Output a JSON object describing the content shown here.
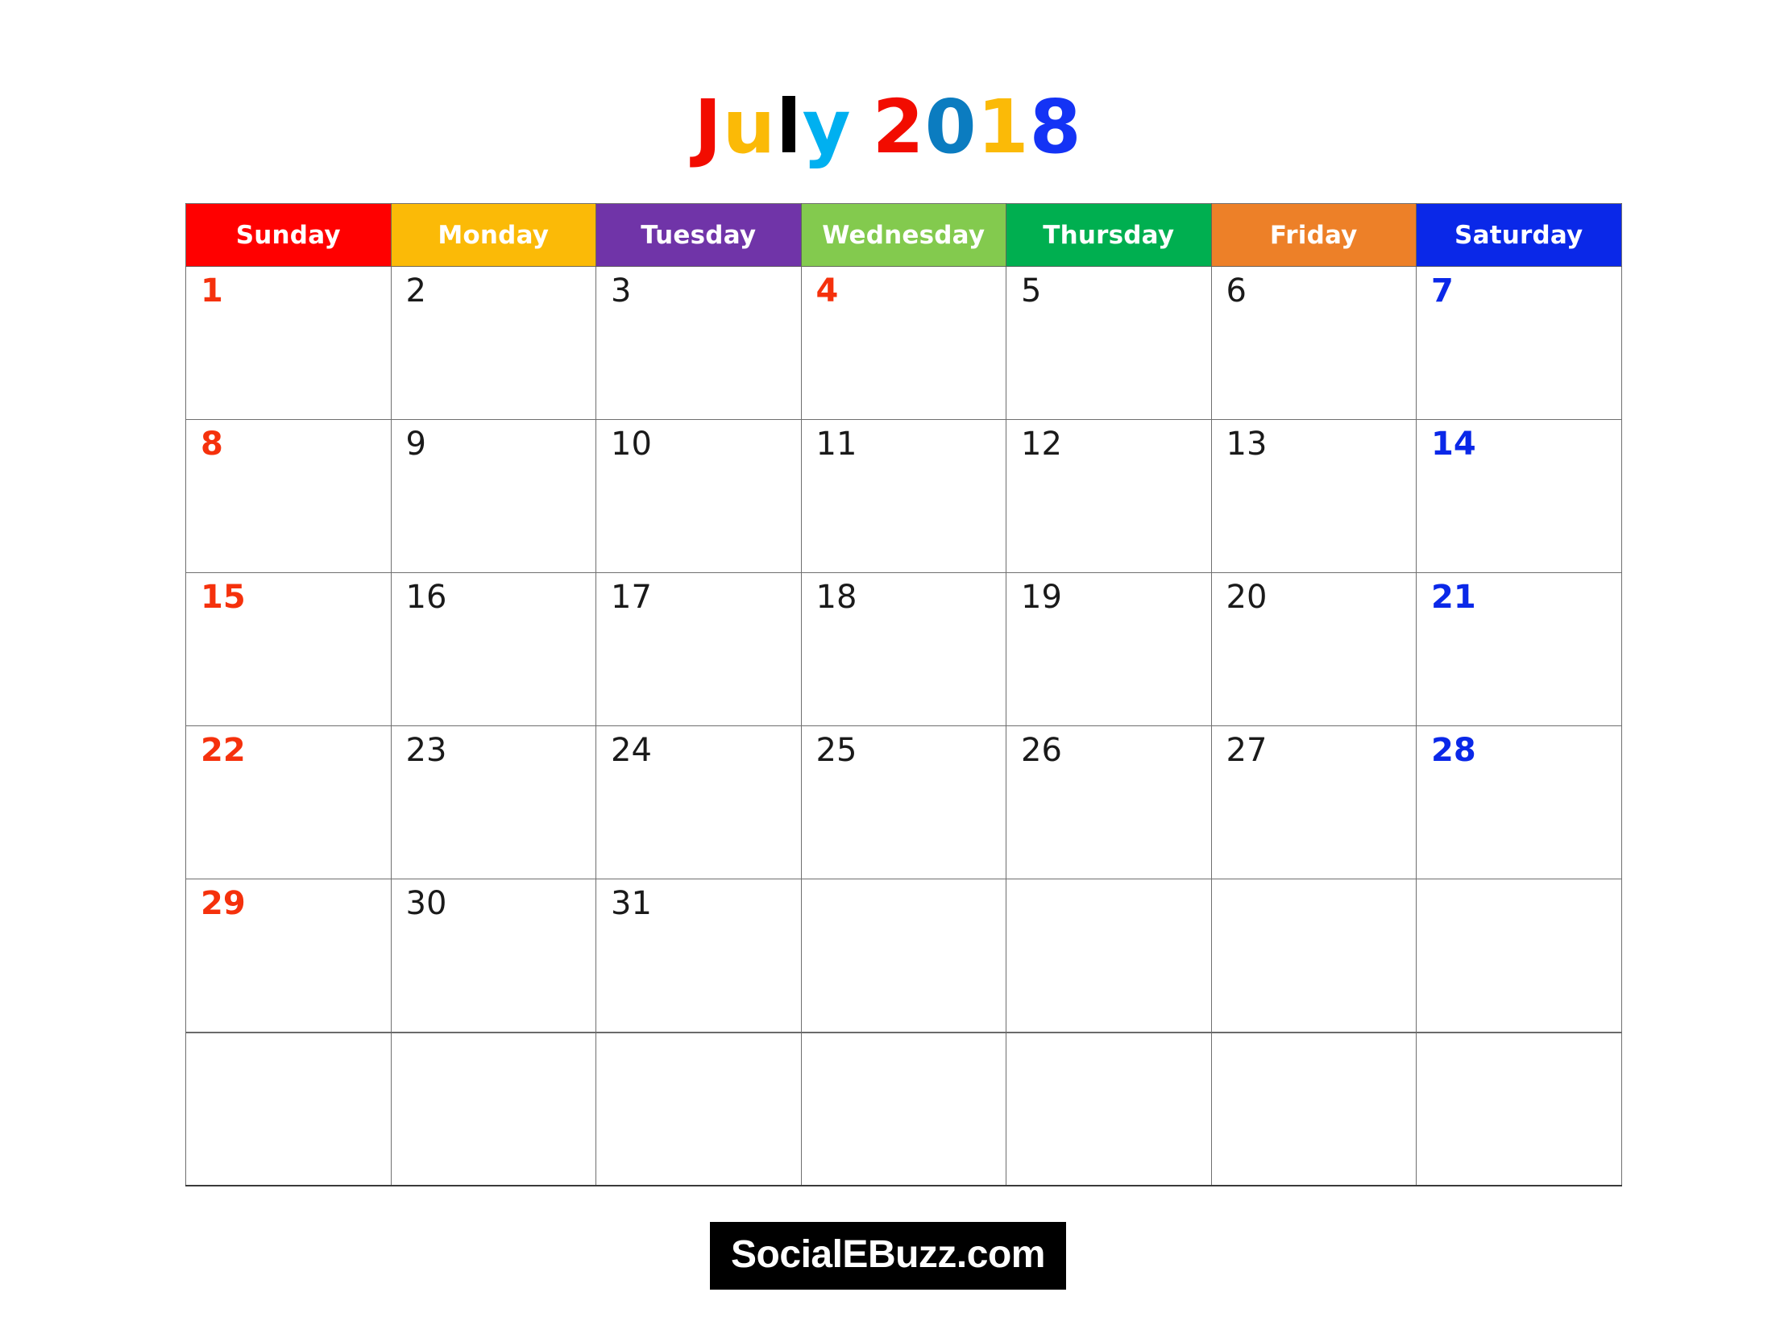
{
  "title": {
    "text": "July 2018",
    "letters": [
      {
        "ch": "J",
        "color": "#F20C00"
      },
      {
        "ch": "u",
        "color": "#FBBA07"
      },
      {
        "ch": "l",
        "color": "#8CC councils"
      },
      {
        "ch": "y",
        "color": "#00B0F0"
      },
      {
        "ch": " ",
        "color": ""
      },
      {
        "ch": "2",
        "color": "#F20C00"
      },
      {
        "ch": "0",
        "color": "#0B7CC0"
      },
      {
        "ch": "1",
        "color": "#FBBA07"
      },
      {
        "ch": "8",
        "color": "#1433F5"
      }
    ]
  },
  "weekdays": [
    {
      "label": "Sunday",
      "bg": "#FF0000"
    },
    {
      "label": "Monday",
      "bg": "#FBBA07"
    },
    {
      "label": "Tuesday",
      "bg": "#7034A8"
    },
    {
      "label": "Wednesday",
      "bg": "#83CA4E"
    },
    {
      "label": "Thursday",
      "bg": "#00AF50"
    },
    {
      "label": "Friday",
      "bg": "#ED8028"
    },
    {
      "label": "Saturday",
      "bg": "#0A28E8"
    }
  ],
  "weeks": [
    [
      {
        "day": "1",
        "style": "sun"
      },
      {
        "day": "2",
        "style": ""
      },
      {
        "day": "3",
        "style": ""
      },
      {
        "day": "4",
        "style": "holiday"
      },
      {
        "day": "5",
        "style": ""
      },
      {
        "day": "6",
        "style": ""
      },
      {
        "day": "7",
        "style": "sat"
      }
    ],
    [
      {
        "day": "8",
        "style": "sun"
      },
      {
        "day": "9",
        "style": ""
      },
      {
        "day": "10",
        "style": ""
      },
      {
        "day": "11",
        "style": ""
      },
      {
        "day": "12",
        "style": ""
      },
      {
        "day": "13",
        "style": ""
      },
      {
        "day": "14",
        "style": "sat"
      }
    ],
    [
      {
        "day": "15",
        "style": "sun"
      },
      {
        "day": "16",
        "style": ""
      },
      {
        "day": "17",
        "style": ""
      },
      {
        "day": "18",
        "style": ""
      },
      {
        "day": "19",
        "style": ""
      },
      {
        "day": "20",
        "style": ""
      },
      {
        "day": "21",
        "style": "sat"
      }
    ],
    [
      {
        "day": "22",
        "style": "sun"
      },
      {
        "day": "23",
        "style": ""
      },
      {
        "day": "24",
        "style": ""
      },
      {
        "day": "25",
        "style": ""
      },
      {
        "day": "26",
        "style": ""
      },
      {
        "day": "27",
        "style": ""
      },
      {
        "day": "28",
        "style": "sat"
      }
    ],
    [
      {
        "day": "29",
        "style": "sun"
      },
      {
        "day": "30",
        "style": ""
      },
      {
        "day": "31",
        "style": ""
      },
      {
        "day": "",
        "style": "empty"
      },
      {
        "day": "",
        "style": "empty"
      },
      {
        "day": "",
        "style": "empty"
      },
      {
        "day": "",
        "style": "empty"
      }
    ],
    [
      {
        "day": "",
        "style": "empty"
      },
      {
        "day": "",
        "style": "empty"
      },
      {
        "day": "",
        "style": "empty"
      },
      {
        "day": "",
        "style": "empty"
      },
      {
        "day": "",
        "style": "empty"
      },
      {
        "day": "",
        "style": "empty"
      },
      {
        "day": "",
        "style": "empty"
      }
    ]
  ],
  "watermark": {
    "text": "SocialEBuzz.com",
    "bg": "#000000",
    "color": "#FFFFFF"
  }
}
